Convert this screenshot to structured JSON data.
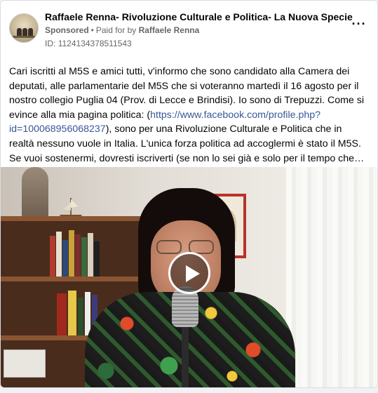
{
  "post": {
    "page_name": "Raffaele Renna- Rivoluzione Culturale e Politica- La Nuova Specie",
    "sponsored_label": "Sponsored",
    "separator": "•",
    "paid_for_label": "Paid for by",
    "payer_name": "Raffaele Renna",
    "ad_id_label": "ID:",
    "ad_id": "1124134378511543",
    "more_icon": "more-options-icon",
    "text": {
      "para1_before_link": "Cari iscritti al M5S e amici tutti, v'informo che sono candidato alla Camera dei deputati, alle parlamentarie del M5S che si voteranno martedì il 16 agosto per il nostro collegio Puglia 04 (Prov. di Lecce e Brindisi). Io sono di Trepuzzi. Come si evince alla mia pagina politica: (",
      "link": "https://www.facebook.com/profile.php?id=100068956068237",
      "para1_after_link": "), sono per una Rivoluzione Culturale e Politica che in realtà nessuno vuole in Italia. L'unica forza politica ad accoglermi è stato il M5S.",
      "para2_truncated": "Se vuoi sostenermi, dovresti iscriverti (se non lo sei già e solo per il tempo che…"
    },
    "video": {
      "play_icon": "play-icon",
      "media_type": "video"
    }
  }
}
